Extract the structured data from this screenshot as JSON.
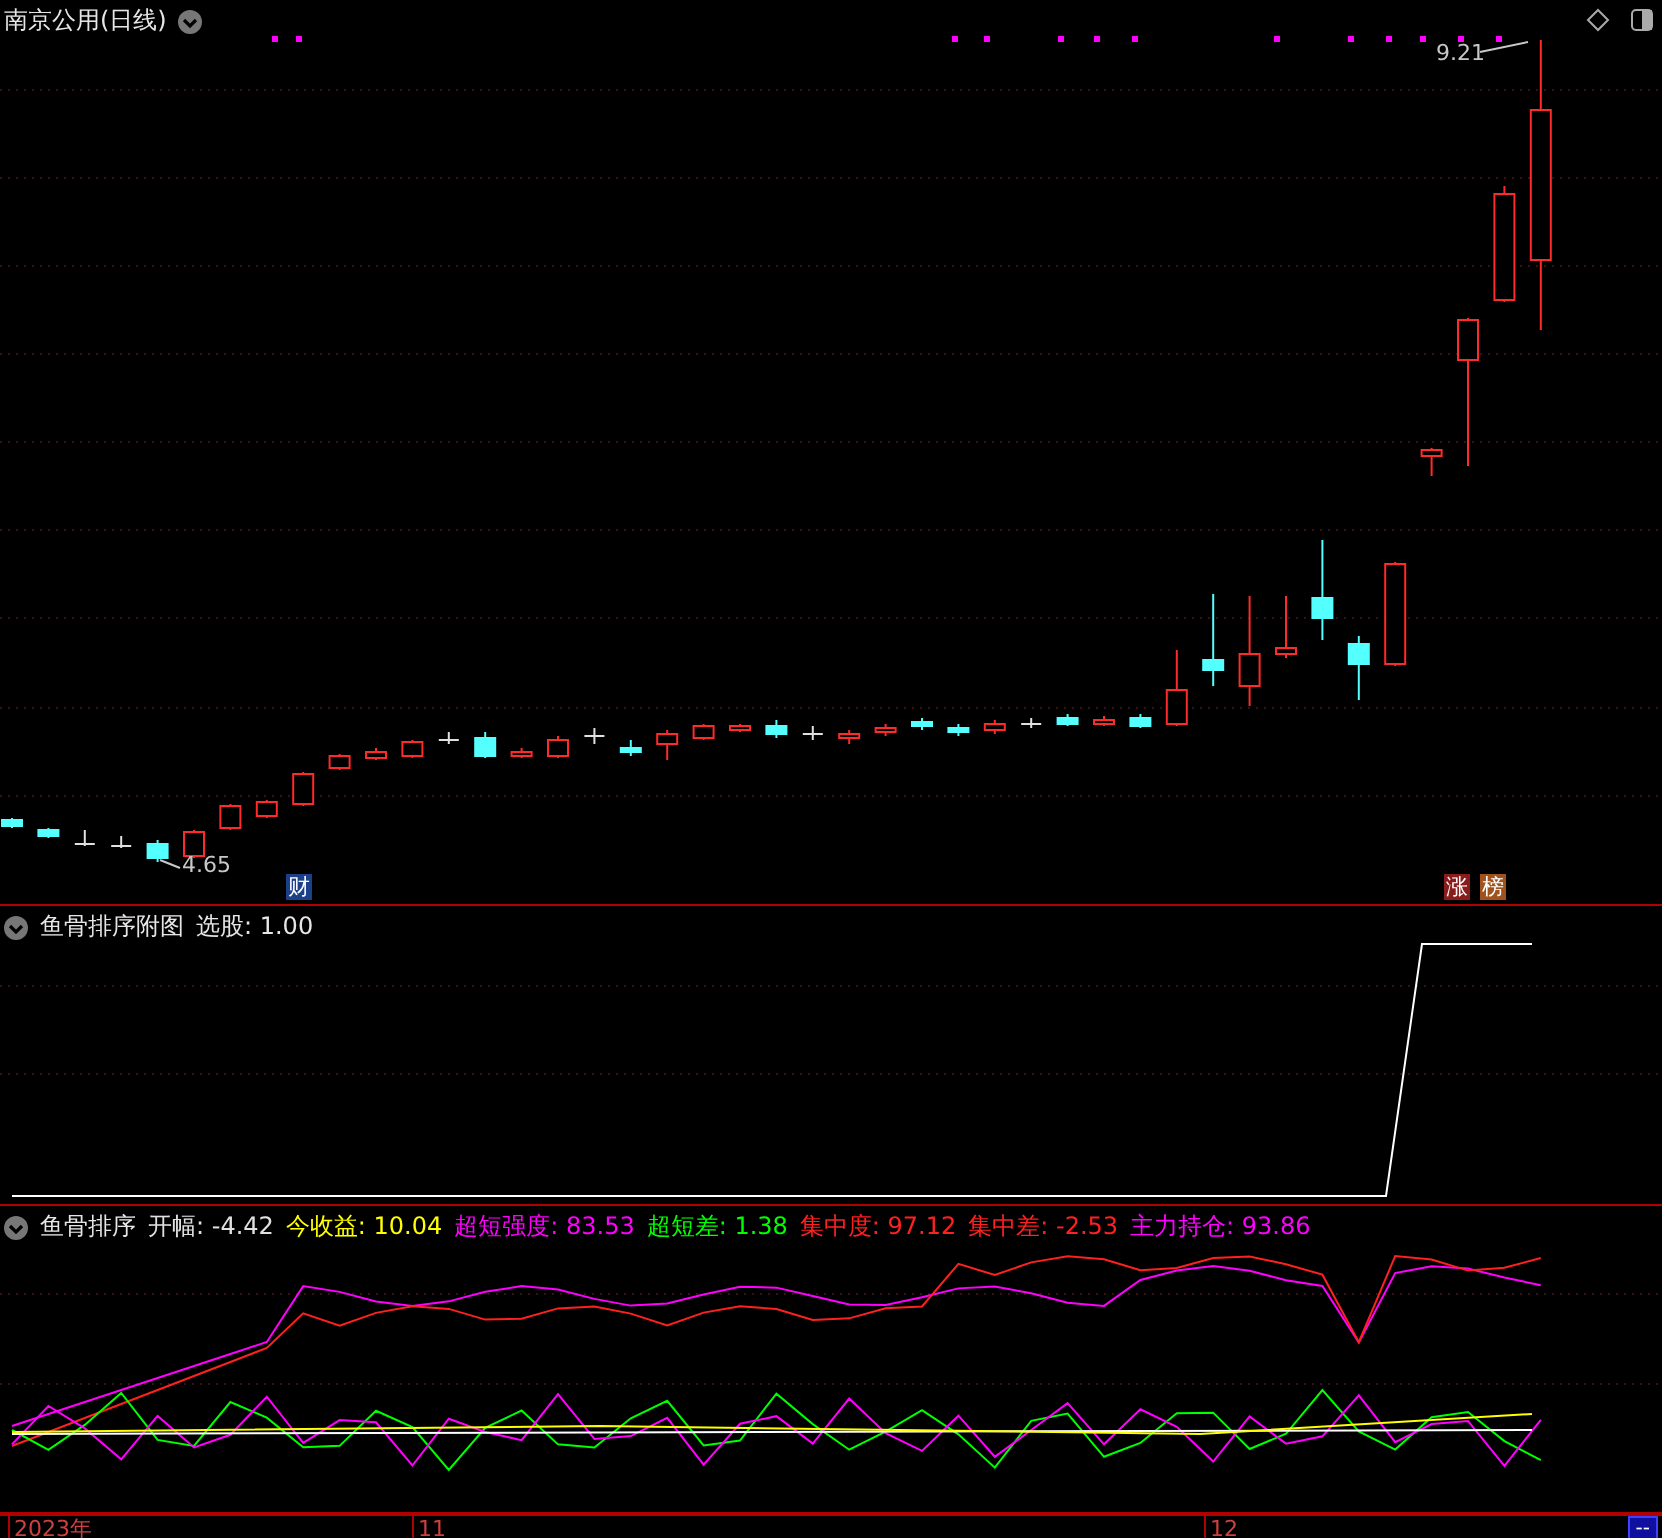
{
  "main_panel": {
    "title": "南京公用(日线)",
    "high_label": "9.21",
    "low_label": "4.65",
    "badges": [
      {
        "text": "财",
        "color": "#1c3f8a"
      },
      {
        "text": "涨",
        "color": "#8a1c1c"
      },
      {
        "text": "榜",
        "color": "#a0521c"
      }
    ]
  },
  "sub_panel": {
    "title": "鱼骨排序附图",
    "reading": "选股: 1.00"
  },
  "indicator_panel": {
    "title": "鱼骨排序",
    "readings": [
      {
        "text": "开幅: -4.42",
        "color": "#e0e0e0"
      },
      {
        "text": "今收益: 10.04",
        "color": "#ffff00"
      },
      {
        "text": "超短强度: 83.53",
        "color": "#ff00ff"
      },
      {
        "text": "超短差: 1.38",
        "color": "#00ff00"
      },
      {
        "text": "集中度: 97.12",
        "color": "#ff2020"
      },
      {
        "text": "集中差: -2.53",
        "color": "#ff2020"
      },
      {
        "text": "主力持仓: 93.86",
        "color": "#ff00ff"
      }
    ]
  },
  "time_axis": {
    "labels": [
      "2023年",
      "11",
      "12"
    ],
    "corner": "--"
  }
}
